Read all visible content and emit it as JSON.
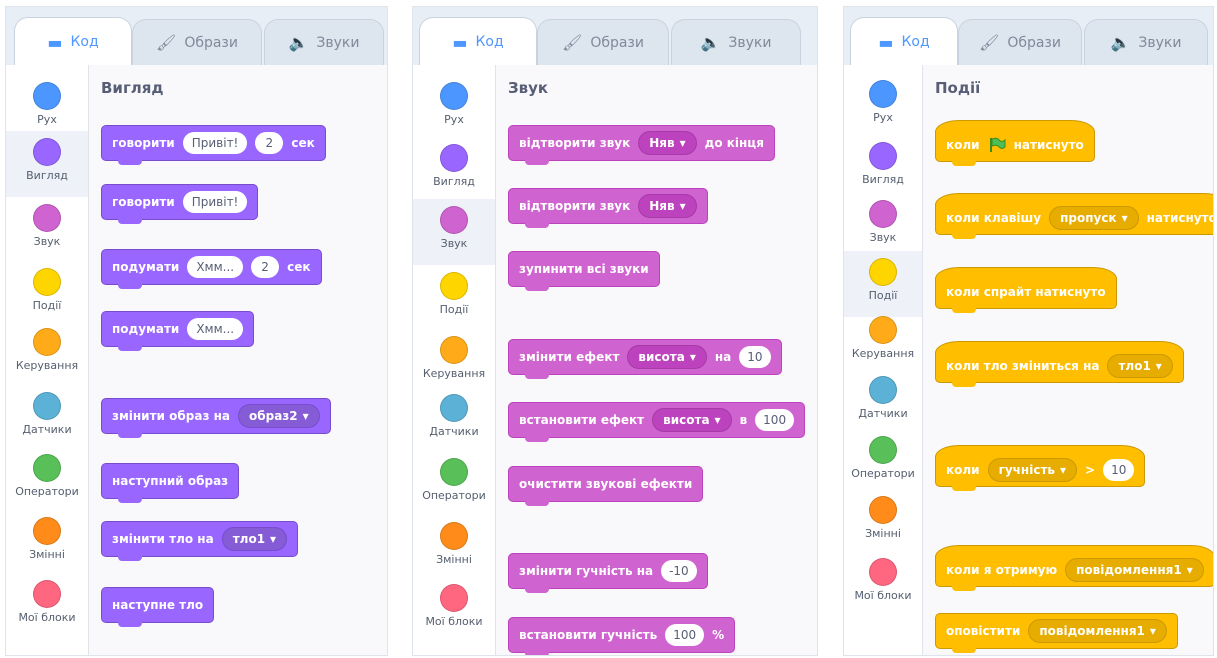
{
  "tabs": {
    "code": "Код",
    "costumes": "Образи",
    "sounds": "Звуки"
  },
  "categories": [
    "Рух",
    "Вигляд",
    "Звук",
    "Події",
    "Керування",
    "Датчики",
    "Оператори",
    "Змінні",
    "Мої блоки"
  ],
  "colors": {
    "motion": "#4c97ff",
    "looks": "#9966ff",
    "sound": "#cf63cf",
    "events": "#ffd500",
    "control": "#ffab19",
    "sensing": "#5cb1d6",
    "operators": "#59c059",
    "variables": "#ff8c1a",
    "myblocks": "#ff6680"
  },
  "panel1": {
    "title": "Вигляд",
    "b1": {
      "text": "говорити",
      "input": "Привіт!",
      "num": "2",
      "suffix": "сек"
    },
    "b2": {
      "text": "говорити",
      "input": "Привіт!"
    },
    "b3": {
      "text": "подумати",
      "input": "Хмм...",
      "num": "2",
      "suffix": "сек"
    },
    "b4": {
      "text": "подумати",
      "input": "Хмм..."
    },
    "b5": {
      "text": "змінити образ на",
      "dropdown": "образ2"
    },
    "b6": {
      "text": "наступний образ"
    },
    "b7": {
      "text": "змінити тло на",
      "dropdown": "тло1"
    },
    "b8": {
      "text": "наступне тло"
    }
  },
  "panel2": {
    "title": "Звук",
    "b1": {
      "text": "відтворити звук",
      "dropdown": "Няв",
      "suffix": "до кінця"
    },
    "b2": {
      "text": "відтворити звук",
      "dropdown": "Няв"
    },
    "b3": {
      "text": "зупинити всі звуки"
    },
    "b4": {
      "text": "змінити ефект",
      "dropdown": "висота",
      "mid": "на",
      "num": "10"
    },
    "b5": {
      "text": "встановити ефект",
      "dropdown": "висота",
      "mid": "в",
      "num": "100"
    },
    "b6": {
      "text": "очистити звукові ефекти"
    },
    "b7": {
      "text": "змінити гучність на",
      "num": "-10"
    },
    "b8": {
      "text": "встановити гучність",
      "num": "100",
      "suffix": "%"
    }
  },
  "panel3": {
    "title": "Події",
    "b1": {
      "text": "коли",
      "suffix": "натиснуто"
    },
    "b2": {
      "text": "коли клавішу",
      "dropdown": "пропуск",
      "suffix": "натиснуто"
    },
    "b3": {
      "text": "коли спрайт натиснуто"
    },
    "b4": {
      "text": "коли тло зміниться на",
      "dropdown": "тло1"
    },
    "b5": {
      "text": "коли",
      "dropdown": "гучність",
      "op": ">",
      "num": "10"
    },
    "b6": {
      "text": "коли я отримую",
      "dropdown": "повідомлення1"
    },
    "b7": {
      "text": "оповістити",
      "dropdown": "повідомлення1"
    }
  }
}
